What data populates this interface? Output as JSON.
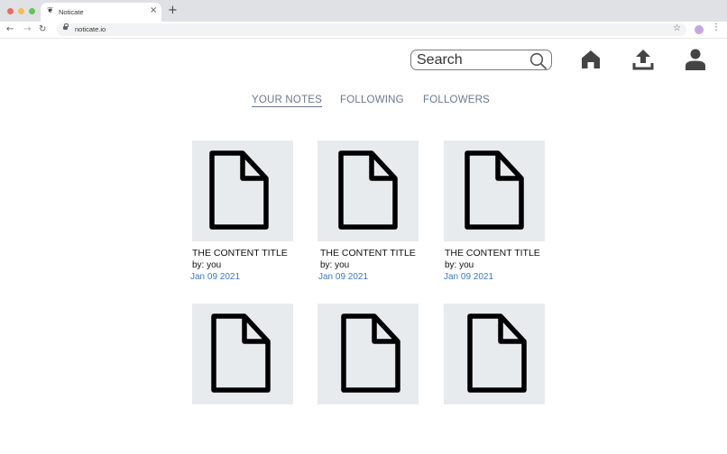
{
  "browser": {
    "tab_title": "Noticate",
    "tab_favicon": "❦",
    "url": "noticate.io",
    "colors": {
      "close": "#ed6a5e",
      "minimize": "#f5bf4f",
      "maximize": "#62c554"
    }
  },
  "header": {
    "search_placeholder": "Search",
    "icons": [
      "search-icon",
      "home-icon",
      "upload-icon",
      "user-icon"
    ]
  },
  "tabs": [
    {
      "label": "YOUR NOTES",
      "active": true
    },
    {
      "label": "FOLLOWING",
      "active": false
    },
    {
      "label": "FOLLOWERS",
      "active": false
    }
  ],
  "notes": [
    {
      "title": "THE CONTENT TITLE",
      "author": "by: you",
      "date": "Jan 09 2021"
    },
    {
      "title": "THE CONTENT TITLE",
      "author": "by: you",
      "date": "Jan 09 2021"
    },
    {
      "title": "THE CONTENT TITLE",
      "author": "by: you",
      "date": "Jan 09 2021"
    },
    {
      "title": "",
      "author": "",
      "date": ""
    },
    {
      "title": "",
      "author": "",
      "date": ""
    },
    {
      "title": "",
      "author": "",
      "date": ""
    }
  ],
  "colors": {
    "accent_tab": "#6b7690",
    "date": "#3a78c4",
    "thumb_bg": "#e8ebee",
    "icon": "#444444"
  }
}
